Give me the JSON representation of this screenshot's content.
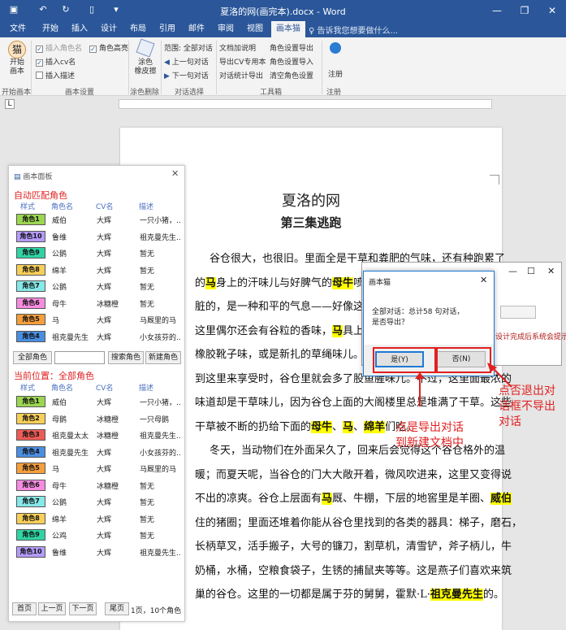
{
  "window": {
    "title": "夏洛的网(画完本).docx - Word",
    "minimize": "—",
    "restore": "❐",
    "close": "✕"
  },
  "tabs": [
    "文件",
    "开始",
    "插入",
    "设计",
    "布局",
    "引用",
    "邮件",
    "审阅",
    "视图",
    "画本猫"
  ],
  "tell_me": "告诉我您想要做什么...",
  "ribbon": {
    "start_big": "开始\n画本",
    "chk_insert_role": "插入角色名",
    "chk_insert_cv": "插入cv名",
    "chk_insert_desc": "插入描述",
    "chk_role_highlight": "角色高亮",
    "eraser": "涂色\n橡皮擦",
    "range": "范围: 全部对话",
    "prev": "上一句对话",
    "next": "下一句对话",
    "doc_desc": "文档加说明",
    "export_cv": "导出CV专用本",
    "stats_export": "对话统计导出",
    "role_export": "角色设置导出",
    "role_import": "角色设置导入",
    "clear_roles": "清空角色设置",
    "register": "注册",
    "groups": [
      "开始画本",
      "画本设置",
      "涂色删除",
      "对话选择",
      "工具箱",
      "注册"
    ]
  },
  "ruler_label": "L",
  "ruler_numbers": [
    "8",
    "6",
    "4",
    "2",
    "",
    "2",
    "4",
    "6",
    "8",
    "10",
    "12",
    "14",
    "16",
    "18",
    "20",
    "22",
    "24",
    "26",
    "28",
    "30",
    "32",
    "34",
    "36",
    "38",
    "",
    "42",
    "44",
    "46",
    "48"
  ],
  "document": {
    "title": "夏洛的网",
    "subtitle": "第三集逃跑",
    "lines": [
      [
        {
          "t": "谷仓很大，也很旧。里面全是干草和粪肥的气味，还有种跑累了"
        }
      ],
      [
        {
          "t": "的"
        },
        {
          "t": "马",
          "h": 1
        },
        {
          "t": "身上的汗味儿与好脾气的"
        },
        {
          "t": "母牛",
          "h": 1
        },
        {
          "t": "喷出"
        }
      ],
      [
        {
          "t": "脏的，是一种和平的气息——好像这个世"
        }
      ],
      [
        {
          "t": "这里偶尔还会有谷粒的香味，"
        },
        {
          "t": "马",
          "h": 1
        },
        {
          "t": "具上的"
        }
      ],
      [
        {
          "t": "橡胶靴子味，或是新扎的草绳味儿。如果"
        }
      ],
      [
        {
          "t": "到这里来享受时，谷仓里就会多了股鱼腥味儿。不过，这里面最浓的"
        }
      ],
      [
        {
          "t": "味道却是干草味儿，因为谷仓上面的大阁楼里总是堆满了干草。这些"
        }
      ],
      [
        {
          "t": "干草被不断的扔给下面的"
        },
        {
          "t": "母牛",
          "h": 1
        },
        {
          "t": "、"
        },
        {
          "t": "马",
          "h": 1
        },
        {
          "t": "、"
        },
        {
          "t": "绵羊",
          "h": 1
        },
        {
          "t": "们吃。"
        }
      ],
      [
        {
          "t": "冬天，当动物们在外面呆久了，回来后会觉得这个谷仓格外的温"
        }
      ],
      [
        {
          "t": "暖；而夏天呢，当谷仓的门大大敞开着，微风吹进来，这里又变得说"
        }
      ],
      [
        {
          "t": "不出的凉爽。谷仓上层面有"
        },
        {
          "t": "马",
          "h": 1
        },
        {
          "t": "厩、牛棚，下层的地窖里是羊圈、"
        },
        {
          "t": "威伯",
          "h": 1
        }
      ],
      [
        {
          "t": "住的猪圈；里面还堆着你能从谷仓里找到的各类的器具：梯子，磨石，"
        }
      ],
      [
        {
          "t": "长柄草叉，活手搬子，大号的镰刀，割草机，清雪铲，斧子柄儿，牛"
        }
      ],
      [
        {
          "t": "奶桶，水桶，空粮食袋子，生锈的捕鼠夹等等。这是燕子们喜欢来筑"
        }
      ],
      [
        {
          "t": "巢的谷仓。这里的一切都是属于芬的舅舅，霍默·L·"
        },
        {
          "t": "祖克曼先生",
          "h": 1
        },
        {
          "t": "的。"
        }
      ]
    ]
  },
  "panel": {
    "title": "画本面板",
    "section_auto": "自动匹配角色",
    "headers": [
      "样式",
      "角色名",
      "CV名",
      "描述"
    ],
    "auto_rows": [
      {
        "badge": "角色1",
        "color": "#9bd651",
        "name": "威伯",
        "cv": "大辉",
        "desc": "一只小猪，..."
      },
      {
        "badge": "角色10",
        "color": "#b59bfc",
        "name": "鲁维",
        "cv": "大辉",
        "desc": "祖克曼先生..."
      },
      {
        "badge": "角色9",
        "color": "#2fd3a4",
        "name": "公鹅",
        "cv": "大辉",
        "desc": "暂无"
      },
      {
        "badge": "角色8",
        "color": "#f7ce58",
        "name": "绵羊",
        "cv": "大辉",
        "desc": "暂无"
      },
      {
        "badge": "角色7",
        "color": "#86e8e8",
        "name": "公鹅",
        "cv": "大辉",
        "desc": "暂无"
      },
      {
        "badge": "角色6",
        "color": "#f68ce0",
        "name": "母牛",
        "cv": "冰糖橙",
        "desc": "暂无"
      },
      {
        "badge": "角色5",
        "color": "#f59e3c",
        "name": "马",
        "cv": "大辉",
        "desc": "马厩里的马"
      },
      {
        "badge": "角色4",
        "color": "#4a8ee0",
        "name": "祖克曼先生",
        "cv": "大辉",
        "desc": "小女孩芬的..."
      }
    ],
    "btn_all": "全部角色",
    "search_value": "",
    "btn_search": "搜索角色",
    "btn_new": "新建角色",
    "section_current": "当前位置：全部角色",
    "current_rows": [
      {
        "badge": "角色1",
        "color": "#9bd651",
        "name": "威伯",
        "cv": "大辉",
        "desc": "一只小猪，..."
      },
      {
        "badge": "角色2",
        "color": "#f7ce58",
        "name": "母鹅",
        "cv": "冰糖橙",
        "desc": "一只母鹅"
      },
      {
        "badge": "角色3",
        "color": "#ec5b54",
        "name": "祖克曼太太",
        "cv": "冰糖橙",
        "desc": "祖克曼先生..."
      },
      {
        "badge": "角色4",
        "color": "#4a8ee0",
        "name": "祖克曼先生",
        "cv": "大辉",
        "desc": "小女孩芬的..."
      },
      {
        "badge": "角色5",
        "color": "#f59e3c",
        "name": "马",
        "cv": "大辉",
        "desc": "马厩里的马"
      },
      {
        "badge": "角色6",
        "color": "#f68ce0",
        "name": "母牛",
        "cv": "冰糖橙",
        "desc": "暂无"
      },
      {
        "badge": "角色7",
        "color": "#86e8e8",
        "name": "公鹅",
        "cv": "大辉",
        "desc": "暂无"
      },
      {
        "badge": "角色8",
        "color": "#f7ce58",
        "name": "绵羊",
        "cv": "大辉",
        "desc": "暂无"
      },
      {
        "badge": "角色9",
        "color": "#2fd3a4",
        "name": "公鸡",
        "cv": "大辉",
        "desc": "暂无"
      },
      {
        "badge": "角色10",
        "color": "#b59bfc",
        "name": "鲁维",
        "cv": "大辉",
        "desc": "祖克曼先生..."
      }
    ],
    "btn_first": "首页",
    "btn_prev": "上一页",
    "btn_next": "下一页",
    "btn_last": "尾页",
    "page_info": "1页，10个角色"
  },
  "bg_dialog": {
    "hint": "设计完成后系统会提示。"
  },
  "dialog": {
    "title": "画本猫",
    "message": "全部对话：总计58 句对话，\n是否导出？",
    "yes": "是(Y)",
    "no": "否(N)"
  },
  "annotations": {
    "left": "点是导出对话\n到新建文档中",
    "right": "点否退出对\n话框不导出\n对话"
  }
}
